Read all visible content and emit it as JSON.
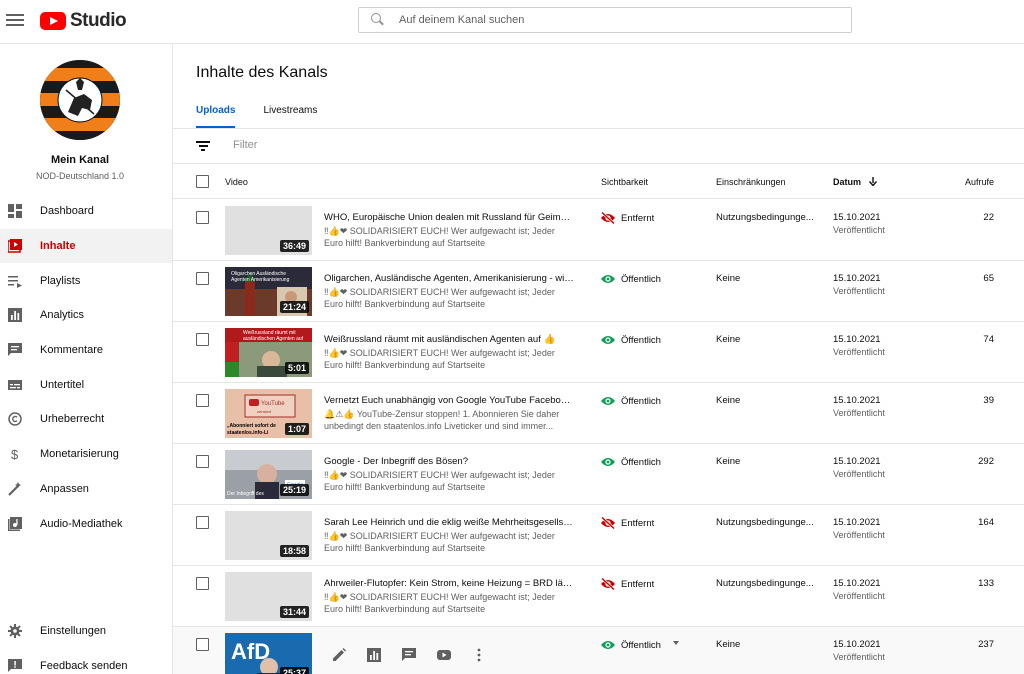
{
  "header": {
    "logo_text": "Studio",
    "search_placeholder": "Auf deinem Kanal suchen"
  },
  "channel": {
    "name": "Mein Kanal",
    "subtitle": "NOD-Deutschland 1.0"
  },
  "sidebar": {
    "items": [
      {
        "label": "Dashboard",
        "icon": "dashboard-icon"
      },
      {
        "label": "Inhalte",
        "icon": "content-icon",
        "active": true
      },
      {
        "label": "Playlists",
        "icon": "playlists-icon"
      },
      {
        "label": "Analytics",
        "icon": "analytics-icon"
      },
      {
        "label": "Kommentare",
        "icon": "comments-icon"
      },
      {
        "label": "Untertitel",
        "icon": "subtitles-icon"
      },
      {
        "label": "Urheberrecht",
        "icon": "copyright-icon"
      },
      {
        "label": "Monetarisierung",
        "icon": "monetization-icon"
      },
      {
        "label": "Anpassen",
        "icon": "customize-icon"
      },
      {
        "label": "Audio-Mediathek",
        "icon": "audio-library-icon"
      }
    ],
    "bottom_items": [
      {
        "label": "Einstellungen",
        "icon": "settings-icon"
      },
      {
        "label": "Feedback senden",
        "icon": "feedback-icon"
      }
    ]
  },
  "main": {
    "title": "Inhalte des Kanals",
    "tabs": [
      {
        "label": "Uploads",
        "active": true
      },
      {
        "label": "Livestreams"
      }
    ],
    "filter_placeholder": "Filter",
    "columns": {
      "video": "Video",
      "visibility": "Sichtbarkeit",
      "restrictions": "Einschränkungen",
      "date": "Datum",
      "views": "Aufrufe"
    }
  },
  "rows": [
    {
      "title": "WHO, Europäische Union dealen mit Russland für Geimpft...",
      "desc": "‼👍❤ SOLIDARISIERT EUCH! Wer aufgewacht ist; Jeder Euro hilft! Bankverbindung auf Startseite https://staatenlos.info/ ...",
      "duration": "36:49",
      "visibility": "Entfernt",
      "restriction": "Nutzungsbedingunge...",
      "date": "15.10.2021",
      "date_sub": "Veröffentlicht",
      "views": "22",
      "thumb": "blank"
    },
    {
      "title": "Oligarchen, Ausländische Agenten, Amerikanisierung - wie...",
      "desc": "‼👍❤ SOLIDARISIERT EUCH! Wer aufgewacht ist; Jeder Euro hilft! Bankverbindung auf Startseite https://staatenlos.info/ ...",
      "duration": "21:24",
      "visibility": "Öffentlich",
      "restriction": "Keine",
      "date": "15.10.2021",
      "date_sub": "Veröffentlicht",
      "views": "65",
      "thumb": "kremlin"
    },
    {
      "title": "Weißrussland räumt mit ausländischen Agenten auf 👍",
      "desc": "‼👍❤ SOLIDARISIERT EUCH! Wer aufgewacht ist; Jeder Euro hilft! Bankverbindung auf Startseite https://staatenlos.info/ ...",
      "duration": "5:01",
      "visibility": "Öffentlich",
      "restriction": "Keine",
      "date": "15.10.2021",
      "date_sub": "Veröffentlicht",
      "views": "74",
      "thumb": "belarus"
    },
    {
      "title": "Vernetzt Euch unabhängig von Google YouTube Facebook...",
      "desc": "🔔⚠👍 YouTube-Zensur stoppen! 1. Abonnieren Sie daher unbedingt den staatenlos.info Liveticker und sind immer...",
      "duration": "1:07",
      "visibility": "Öffentlich",
      "restriction": "Keine",
      "date": "15.10.2021",
      "date_sub": "Veröffentlicht",
      "views": "39",
      "thumb": "youtube"
    },
    {
      "title": "Google - Der Inbegriff des Bösen?",
      "desc": "‼👍❤ SOLIDARISIERT EUCH! Wer aufgewacht ist; Jeder Euro hilft! Bankverbindung auf Startseite https://staatenlos.info/ ...",
      "duration": "25:19",
      "visibility": "Öffentlich",
      "restriction": "Keine",
      "date": "15.10.2021",
      "date_sub": "Veröffentlicht",
      "views": "292",
      "thumb": "google"
    },
    {
      "title": "Sarah Lee Heinrich und die eklig weiße Mehrheitsgesellsc...",
      "desc": "‼👍❤ SOLIDARISIERT EUCH! Wer aufgewacht ist; Jeder Euro hilft! Bankverbindung auf Startseite https://staatenlos.info/ ...",
      "duration": "18:58",
      "visibility": "Entfernt",
      "restriction": "Nutzungsbedingunge...",
      "date": "15.10.2021",
      "date_sub": "Veröffentlicht",
      "views": "164",
      "thumb": "blank"
    },
    {
      "title": "Ahrweiler-Flutopfer: Kein Strom, keine Heizung = BRD läss...",
      "desc": "‼👍❤ SOLIDARISIERT EUCH! Wer aufgewacht ist; Jeder Euro hilft! Bankverbindung auf Startseite https://staatenlos.info/ ...",
      "duration": "31:44",
      "visibility": "Entfernt",
      "restriction": "Nutzungsbedingunge...",
      "date": "15.10.2021",
      "date_sub": "Veröffentlicht",
      "views": "133",
      "thumb": "blank"
    },
    {
      "title": "",
      "desc": "",
      "duration": "25:37",
      "visibility": "Öffentlich",
      "restriction": "Keine",
      "date": "15.10.2021",
      "date_sub": "Veröffentlicht",
      "views": "237",
      "thumb": "afd",
      "hover": true
    }
  ],
  "colors": {
    "accent": "#065fd4",
    "active_nav": "#cc0000",
    "public_green": "#0f9d58",
    "removed_red": "#cc0000"
  }
}
